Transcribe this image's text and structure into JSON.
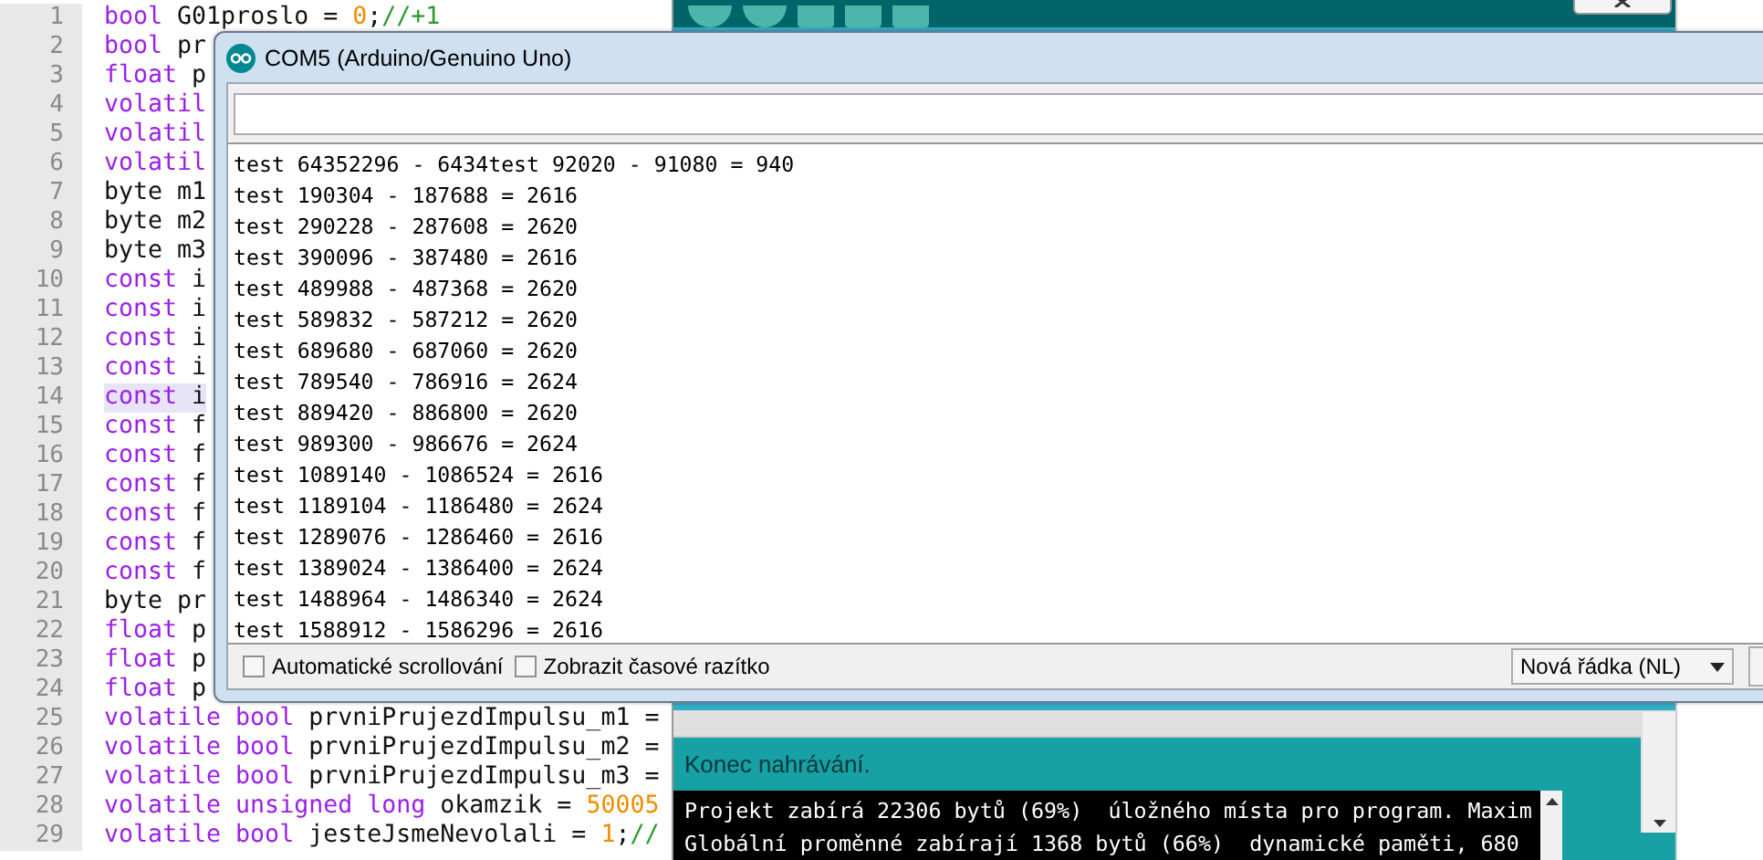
{
  "editor": {
    "lines": [
      {
        "number": "1",
        "highlighted": false,
        "tokens": [
          {
            "kind": "keyword",
            "text": "bool"
          },
          {
            "kind": "plain",
            "text": " G01proslo = "
          },
          {
            "kind": "number",
            "text": "0"
          },
          {
            "kind": "plain",
            "text": ";"
          },
          {
            "kind": "comment",
            "text": "//+1"
          }
        ]
      },
      {
        "number": "2",
        "highlighted": false,
        "tokens": [
          {
            "kind": "keyword",
            "text": "bool"
          },
          {
            "kind": "plain",
            "text": " pr"
          }
        ]
      },
      {
        "number": "3",
        "highlighted": false,
        "tokens": [
          {
            "kind": "keyword",
            "text": "float"
          },
          {
            "kind": "plain",
            "text": " p"
          }
        ]
      },
      {
        "number": "4",
        "highlighted": false,
        "tokens": [
          {
            "kind": "keyword",
            "text": "volatil"
          }
        ]
      },
      {
        "number": "5",
        "highlighted": false,
        "tokens": [
          {
            "kind": "keyword",
            "text": "volatil"
          }
        ]
      },
      {
        "number": "6",
        "highlighted": false,
        "tokens": [
          {
            "kind": "keyword",
            "text": "volatil"
          }
        ]
      },
      {
        "number": "7",
        "highlighted": false,
        "tokens": [
          {
            "kind": "plain",
            "text": "byte m1"
          }
        ]
      },
      {
        "number": "8",
        "highlighted": false,
        "tokens": [
          {
            "kind": "plain",
            "text": "byte m2"
          }
        ]
      },
      {
        "number": "9",
        "highlighted": false,
        "tokens": [
          {
            "kind": "plain",
            "text": "byte m3"
          }
        ]
      },
      {
        "number": "10",
        "highlighted": false,
        "tokens": [
          {
            "kind": "keyword",
            "text": "const"
          },
          {
            "kind": "plain",
            "text": " i"
          }
        ]
      },
      {
        "number": "11",
        "highlighted": false,
        "tokens": [
          {
            "kind": "keyword",
            "text": "const"
          },
          {
            "kind": "plain",
            "text": " i"
          }
        ]
      },
      {
        "number": "12",
        "highlighted": false,
        "tokens": [
          {
            "kind": "keyword",
            "text": "const"
          },
          {
            "kind": "plain",
            "text": " i"
          }
        ]
      },
      {
        "number": "13",
        "highlighted": false,
        "tokens": [
          {
            "kind": "keyword",
            "text": "const"
          },
          {
            "kind": "plain",
            "text": " i"
          }
        ]
      },
      {
        "number": "14",
        "highlighted": true,
        "tokens": [
          {
            "kind": "keyword",
            "text": "const"
          },
          {
            "kind": "plain",
            "text": " i"
          }
        ]
      },
      {
        "number": "15",
        "highlighted": false,
        "tokens": [
          {
            "kind": "keyword",
            "text": "const"
          },
          {
            "kind": "plain",
            "text": " f"
          }
        ]
      },
      {
        "number": "16",
        "highlighted": false,
        "tokens": [
          {
            "kind": "keyword",
            "text": "const"
          },
          {
            "kind": "plain",
            "text": " f"
          }
        ]
      },
      {
        "number": "17",
        "highlighted": false,
        "tokens": [
          {
            "kind": "keyword",
            "text": "const"
          },
          {
            "kind": "plain",
            "text": " f"
          }
        ]
      },
      {
        "number": "18",
        "highlighted": false,
        "tokens": [
          {
            "kind": "keyword",
            "text": "const"
          },
          {
            "kind": "plain",
            "text": " f"
          }
        ]
      },
      {
        "number": "19",
        "highlighted": false,
        "tokens": [
          {
            "kind": "keyword",
            "text": "const"
          },
          {
            "kind": "plain",
            "text": " f"
          }
        ]
      },
      {
        "number": "20",
        "highlighted": false,
        "tokens": [
          {
            "kind": "keyword",
            "text": "const"
          },
          {
            "kind": "plain",
            "text": " f"
          }
        ]
      },
      {
        "number": "21",
        "highlighted": false,
        "tokens": [
          {
            "kind": "plain",
            "text": "byte pr"
          }
        ]
      },
      {
        "number": "22",
        "highlighted": false,
        "tokens": [
          {
            "kind": "keyword",
            "text": "float"
          },
          {
            "kind": "plain",
            "text": " p"
          }
        ]
      },
      {
        "number": "23",
        "highlighted": false,
        "tokens": [
          {
            "kind": "keyword",
            "text": "float"
          },
          {
            "kind": "plain",
            "text": " p"
          }
        ]
      },
      {
        "number": "24",
        "highlighted": false,
        "tokens": [
          {
            "kind": "keyword",
            "text": "float"
          },
          {
            "kind": "plain",
            "text": " p"
          }
        ]
      },
      {
        "number": "25",
        "highlighted": false,
        "tokens": [
          {
            "kind": "keyword",
            "text": "volatile bool"
          },
          {
            "kind": "plain",
            "text": " prvniPrujezdImpulsu_m1 ="
          }
        ]
      },
      {
        "number": "26",
        "highlighted": false,
        "tokens": [
          {
            "kind": "keyword",
            "text": "volatile bool"
          },
          {
            "kind": "plain",
            "text": " prvniPrujezdImpulsu_m2 ="
          }
        ]
      },
      {
        "number": "27",
        "highlighted": false,
        "tokens": [
          {
            "kind": "keyword",
            "text": "volatile bool"
          },
          {
            "kind": "plain",
            "text": " prvniPrujezdImpulsu_m3 ="
          }
        ]
      },
      {
        "number": "28",
        "highlighted": false,
        "tokens": [
          {
            "kind": "keyword",
            "text": "volatile unsigned long"
          },
          {
            "kind": "plain",
            "text": " okamzik = "
          },
          {
            "kind": "number",
            "text": "50005"
          }
        ]
      },
      {
        "number": "29",
        "highlighted": false,
        "tokens": [
          {
            "kind": "keyword",
            "text": "volatile bool"
          },
          {
            "kind": "plain",
            "text": " jesteJsmeNevolali = "
          },
          {
            "kind": "number",
            "text": "1"
          },
          {
            "kind": "plain",
            "text": ";"
          },
          {
            "kind": "comment",
            "text": "//"
          }
        ]
      }
    ]
  },
  "ide": {
    "message": "Konec nahrávání.",
    "console": [
      "Projekt zabírá 22306 bytů (69%)  úložného místa pro program. Maxim",
      "Globální proměnné zabírají 1368 bytů (66%)  dynamické paměti, 680"
    ]
  },
  "serial_monitor": {
    "title": "COM5 (Arduino/Genuino Uno)",
    "output": [
      "test 64352296 - 6434test 92020 - 91080 = 940",
      "test 190304 - 187688 = 2616",
      "test 290228 - 287608 = 2620",
      "test 390096 - 387480 = 2616",
      "test 489988 - 487368 = 2620",
      "test 589832 - 587212 = 2620",
      "test 689680 - 687060 = 2620",
      "test 789540 - 786916 = 2624",
      "test 889420 - 886800 = 2620",
      "test 989300 - 986676 = 2624",
      "test 1089140 - 1086524 = 2616",
      "test 1189104 - 1186480 = 2624",
      "test 1289076 - 1286460 = 2616",
      "test 1389024 - 1386400 = 2624",
      "test 1488964 - 1486340 = 2624",
      "test 1588912 - 1586296 = 2616"
    ],
    "options": [
      {
        "label": "Automatické scrollování",
        "checked": false
      },
      {
        "label": "Zobrazit časové razítko",
        "checked": false
      }
    ],
    "line_ending": "Nová řádka (NL)"
  }
}
